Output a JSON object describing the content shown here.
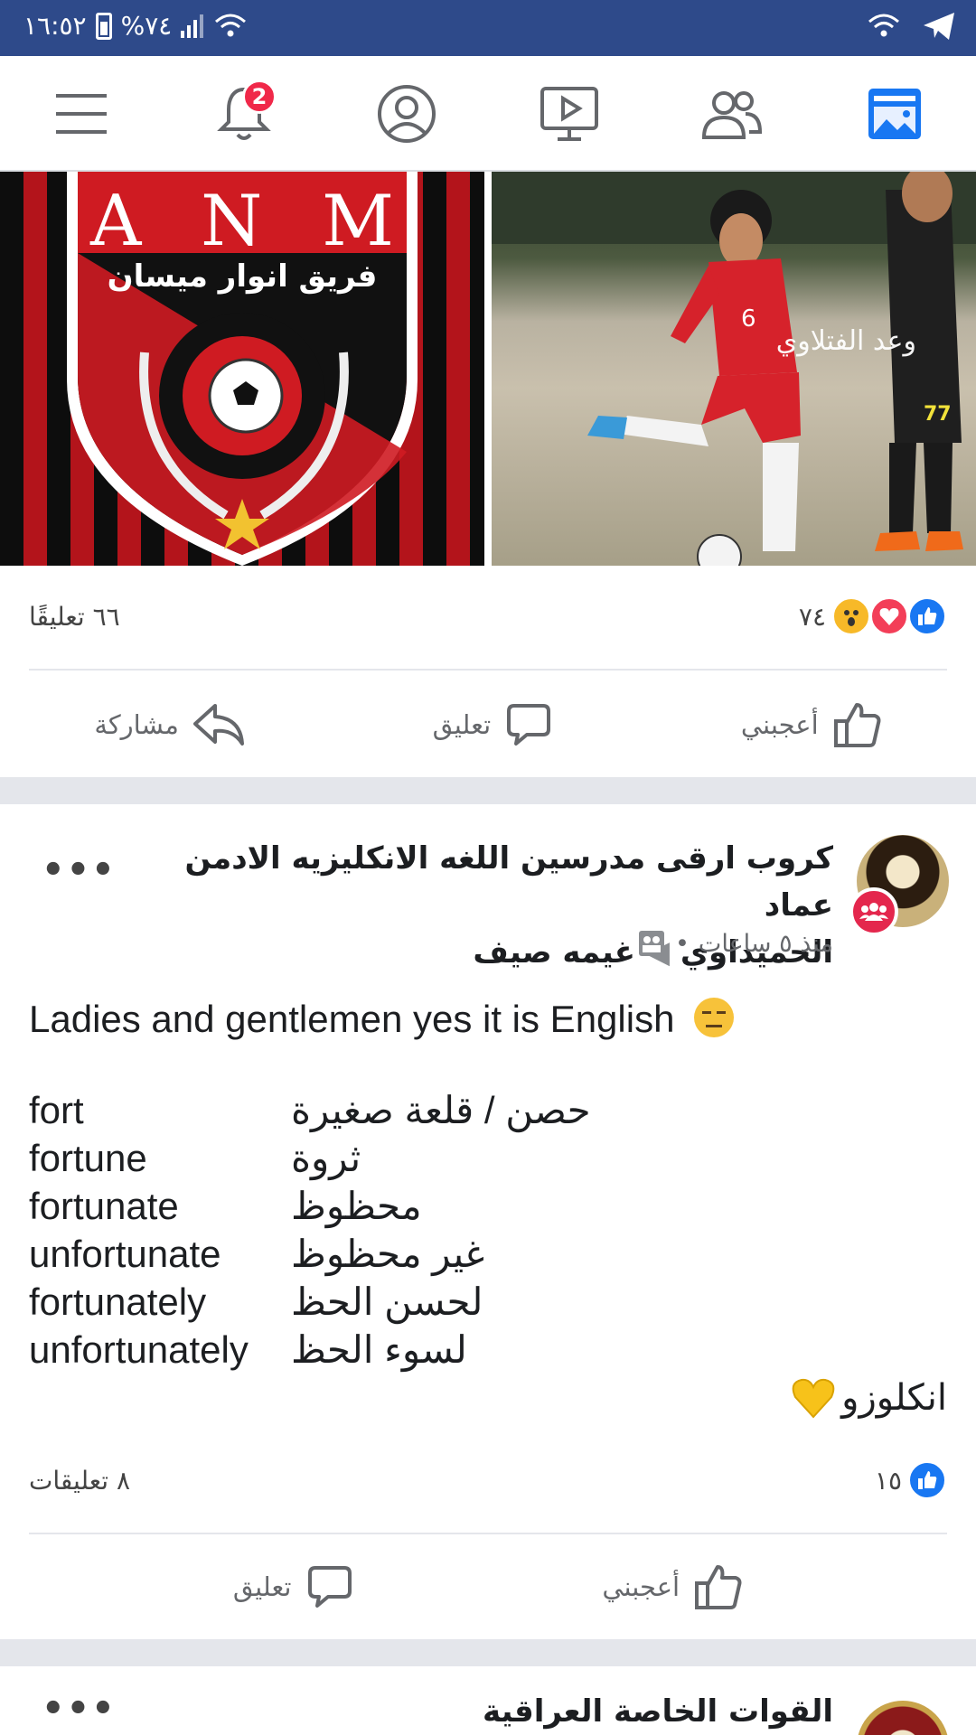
{
  "status_bar": {
    "time": "١٦:٥٢",
    "battery": "%٧٤"
  },
  "nav": {
    "notification_count": "2"
  },
  "photo_post": {
    "left_image": {
      "letters": [
        "A",
        "N",
        "M"
      ],
      "team_name": "فريق انوار ميسان"
    },
    "right_image": {
      "watermark": "وعد الفتلاوي",
      "jersey_number": "6",
      "jersey_number_2": "77"
    },
    "reaction_count": "٧٤",
    "comment_count": "٦٦ تعليقًا",
    "actions": {
      "like": "أعجبني",
      "comment": "تعليق",
      "share": "مشاركة"
    }
  },
  "text_post": {
    "title_line1": "كروب ارقى مدرسين اللغه الانكليزيه الادمن عماد",
    "title_line2_group": "الحميداوي",
    "title_line2_user": "غيمه صيف",
    "time": "منذ ٥ ساعات",
    "intro": "Ladies and gentlemen yes it is English",
    "vocab": [
      {
        "en": "fort",
        "ar": "حصن / قلعة صغيرة"
      },
      {
        "en": "fortune",
        "ar": "ثروة"
      },
      {
        "en": "fortunate",
        "ar": "محظوظ"
      },
      {
        "en": "unfortunate",
        "ar": "غير محظوظ"
      },
      {
        "en": "fortunately",
        "ar": "لحسن الحظ"
      },
      {
        "en": "unfortunately",
        "ar": "لسوء الحظ"
      }
    ],
    "signoff": "انكلوزو",
    "like_count": "١٥",
    "comment_count": "٨ تعليقات",
    "actions": {
      "like": "أعجبني",
      "comment": "تعليق"
    }
  },
  "next_post": {
    "title": "القوات الخاصة العراقية"
  },
  "colors": {
    "status_bar": "#2e4a8a",
    "facebook_blue": "#1877f2",
    "badge_red": "#f02849",
    "group_red": "#e4274d"
  }
}
